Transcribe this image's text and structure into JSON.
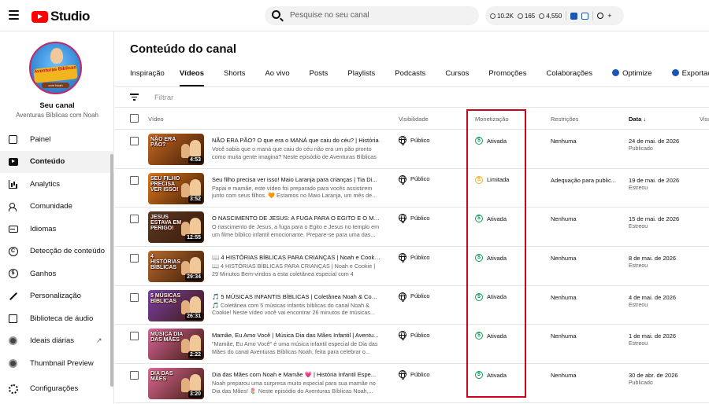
{
  "header": {
    "logo_text": "Studio",
    "search_placeholder": "Pesquise no seu canal",
    "stats": [
      "10.2K",
      "165",
      "4,550"
    ]
  },
  "sidebar": {
    "avatar_text": "Aventuras Bíblicas",
    "avatar_sub": "com Noah",
    "channel_label": "Seu canal",
    "channel_name": "Aventuras Bíblicas com Noah",
    "items": [
      {
        "label": "Painel",
        "icon": "dashboard-icon"
      },
      {
        "label": "Conteúdo",
        "icon": "content-icon",
        "active": true
      },
      {
        "label": "Analytics",
        "icon": "analytics-icon"
      },
      {
        "label": "Comunidade",
        "icon": "community-icon"
      },
      {
        "label": "Idiomas",
        "icon": "subtitles-icon"
      },
      {
        "label": "Detecção de conteúdo",
        "icon": "copyright-icon"
      },
      {
        "label": "Ganhos",
        "icon": "dollar-icon"
      },
      {
        "label": "Personalização",
        "icon": "wand-icon"
      },
      {
        "label": "Biblioteca de áudio",
        "icon": "audio-library-icon"
      },
      {
        "label": "Ideais diárias",
        "icon": "extension-icon",
        "external": true
      },
      {
        "label": "Thumbnail Preview",
        "icon": "extension-icon"
      },
      {
        "label": "Configurações",
        "icon": "gear-icon"
      }
    ]
  },
  "main": {
    "title": "Conteúdo do canal",
    "tabs": [
      "Inspiração",
      "Vídeos",
      "Shorts",
      "Ao vivo",
      "Posts",
      "Playlists",
      "Podcasts",
      "Cursos",
      "Promoções",
      "Colaborações",
      "Optimize",
      "Exportação de"
    ],
    "active_tab": "Vídeos",
    "filter_placeholder": "Filtrar",
    "columns": {
      "video": "Vídeo",
      "visibility": "Visibilidade",
      "monetization": "Monetização",
      "restrictions": "Restrições",
      "date": "Data ↓",
      "views": "Visu"
    },
    "videos": [
      {
        "title": "NÃO ERA PÃO? O que era o MANÁ que caiu do céu? | História",
        "desc": "Você sabia que o maná que caiu do céu não era um pão pronto como muita gente imagina? Neste episódio de Aventuras Bíblicas",
        "duration": "4:53",
        "thumb_text": "NÃO ERA PÃO?",
        "visibility": "Público",
        "monetization": "Ativada",
        "limited": false,
        "restrictions": "Nenhuma",
        "date": "24 de mai. de 2026",
        "date_status": "Publicado",
        "thumb_bg": "#c86a1e"
      },
      {
        "title": "Seu filho precisa ver isso! Maio Laranja para crianças | Tia Di...",
        "desc": "Papai e mamãe, este vídeo foi preparado para vocês assistirem junto com seus filhos. 🧡 Estamos no Maio Laranja, um mês de...",
        "duration": "3:52",
        "thumb_text": "SEU FILHO PRECISA VER ISSO!",
        "visibility": "Público",
        "monetization": "Limitada",
        "limited": true,
        "restrictions": "Adequação para public...",
        "date": "19 de mai. de 2026",
        "date_status": "Estreou",
        "thumb_bg": "#e07a1a"
      },
      {
        "title": "O NASCIMENTO DE JESUS: A FUGA PARA O EGITO E O MENI...",
        "desc": "O nascimento de Jesus, a fuga para o Egito e Jesus no templo em um filme bíblico infantil emocionante. Prepare-se para uma das...",
        "duration": "12:55",
        "thumb_text": "JESUS ESTAVA EM PERIGO!",
        "visibility": "Público",
        "monetization": "Ativada",
        "limited": false,
        "restrictions": "Nenhuma",
        "date": "15 de mai. de 2026",
        "date_status": "Estreou",
        "thumb_bg": "#5a3a22"
      },
      {
        "title": "📖 4 HISTÓRIAS BÍBLICAS PARA CRIANÇAS | Noah e Cookie ...",
        "desc": "📖 4 HISTÓRIAS BÍBLICAS PARA CRIANÇAS | Noah e Cookie | 29 Minutos Bem-vindos a esta coletânea especial com 4 histórias...",
        "duration": "29:34",
        "thumb_text": "4 HISTÓRIAS BÍBLICAS",
        "visibility": "Público",
        "monetization": "Ativada",
        "limited": false,
        "restrictions": "Nenhuma",
        "date": "8 de mai. de 2026",
        "date_status": "Estreou",
        "thumb_bg": "#b86a2a"
      },
      {
        "title": "🎵 5 MÚSICAS INFANTIS BÍBLICAS | Coletânea Noah & Cook...",
        "desc": "🎵 Coletânea com 5 músicas infantis bíblicas do canal Noah & Cookie! Neste vídeo você vai encontrar 26 minutos de músicas...",
        "duration": "26:31",
        "thumb_text": "5 MÚSICAS BÍBLICAS",
        "visibility": "Público",
        "monetization": "Ativada",
        "limited": false,
        "restrictions": "Nenhuma",
        "date": "4 de mai. de 2026",
        "date_status": "Estreou",
        "thumb_bg": "#7d3fa8"
      },
      {
        "title": "Mamãe, Eu Amo Você | Música Dia das Mães Infantil | Aventu...",
        "desc": "\"Mamãe, Eu Amo Você\" é uma música infantil especial de Dia das Mães do canal Aventuras Bíblicas Noah, feita para celebrar o...",
        "duration": "2:22",
        "thumb_text": "MÚSICA DIA DAS MÃES",
        "visibility": "Público",
        "monetization": "Ativada",
        "limited": false,
        "restrictions": "Nenhuma",
        "date": "1 de mai. de 2026",
        "date_status": "Estreou",
        "thumb_bg": "#d8659a"
      },
      {
        "title": "Dia das Mães com Noah e Mamãe 💗 | História Infantil Espe...",
        "desc": "Noah preparou uma surpresa muito especial para sua mamãe no Dia das Mães! 🌷 Neste episódio do Aventuras Bíblicas Noah,...",
        "duration": "3:20",
        "thumb_text": "DIA DAS MÃES",
        "visibility": "Público",
        "monetization": "Ativada",
        "limited": false,
        "restrictions": "Nenhuma",
        "date": "30 de abr. de 2026",
        "date_status": "Publicado",
        "thumb_bg": "#e06a9a"
      }
    ]
  },
  "colors": {
    "brand_red": "#ff0000",
    "monetized_green": "#0f9d58",
    "limited_yellow": "#f2b01e",
    "highlight_red": "#d0021b"
  }
}
